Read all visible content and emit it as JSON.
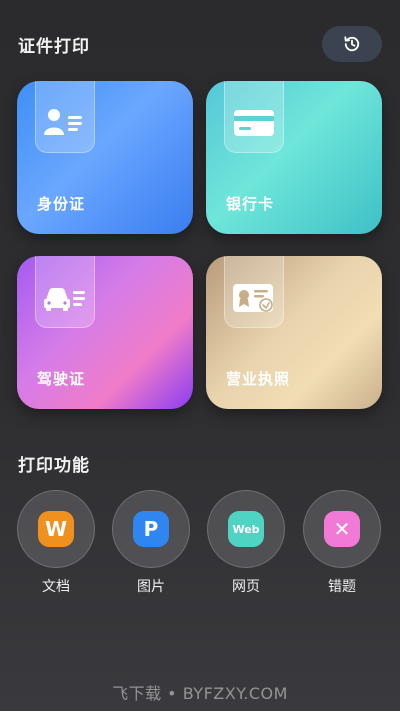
{
  "header": {
    "title": "证件打印",
    "history_icon": "history-icon"
  },
  "cards": [
    {
      "label": "身份证",
      "icon": "id-card-icon"
    },
    {
      "label": "银行卡",
      "icon": "bank-card-icon"
    },
    {
      "label": "驾驶证",
      "icon": "car-license-icon"
    },
    {
      "label": "营业执照",
      "icon": "business-license-icon"
    }
  ],
  "functions": {
    "title": "打印功能",
    "items": [
      {
        "label": "文档",
        "badge": "W",
        "color": "#f0901e"
      },
      {
        "label": "图片",
        "badge": "P",
        "color": "#2f86f0"
      },
      {
        "label": "网页",
        "badge": "Web",
        "color": "#4fd3c2"
      },
      {
        "label": "错题",
        "badge": "✕",
        "color": "#f07ad6"
      }
    ]
  },
  "watermark": "飞下载 • BYFZXY.COM"
}
